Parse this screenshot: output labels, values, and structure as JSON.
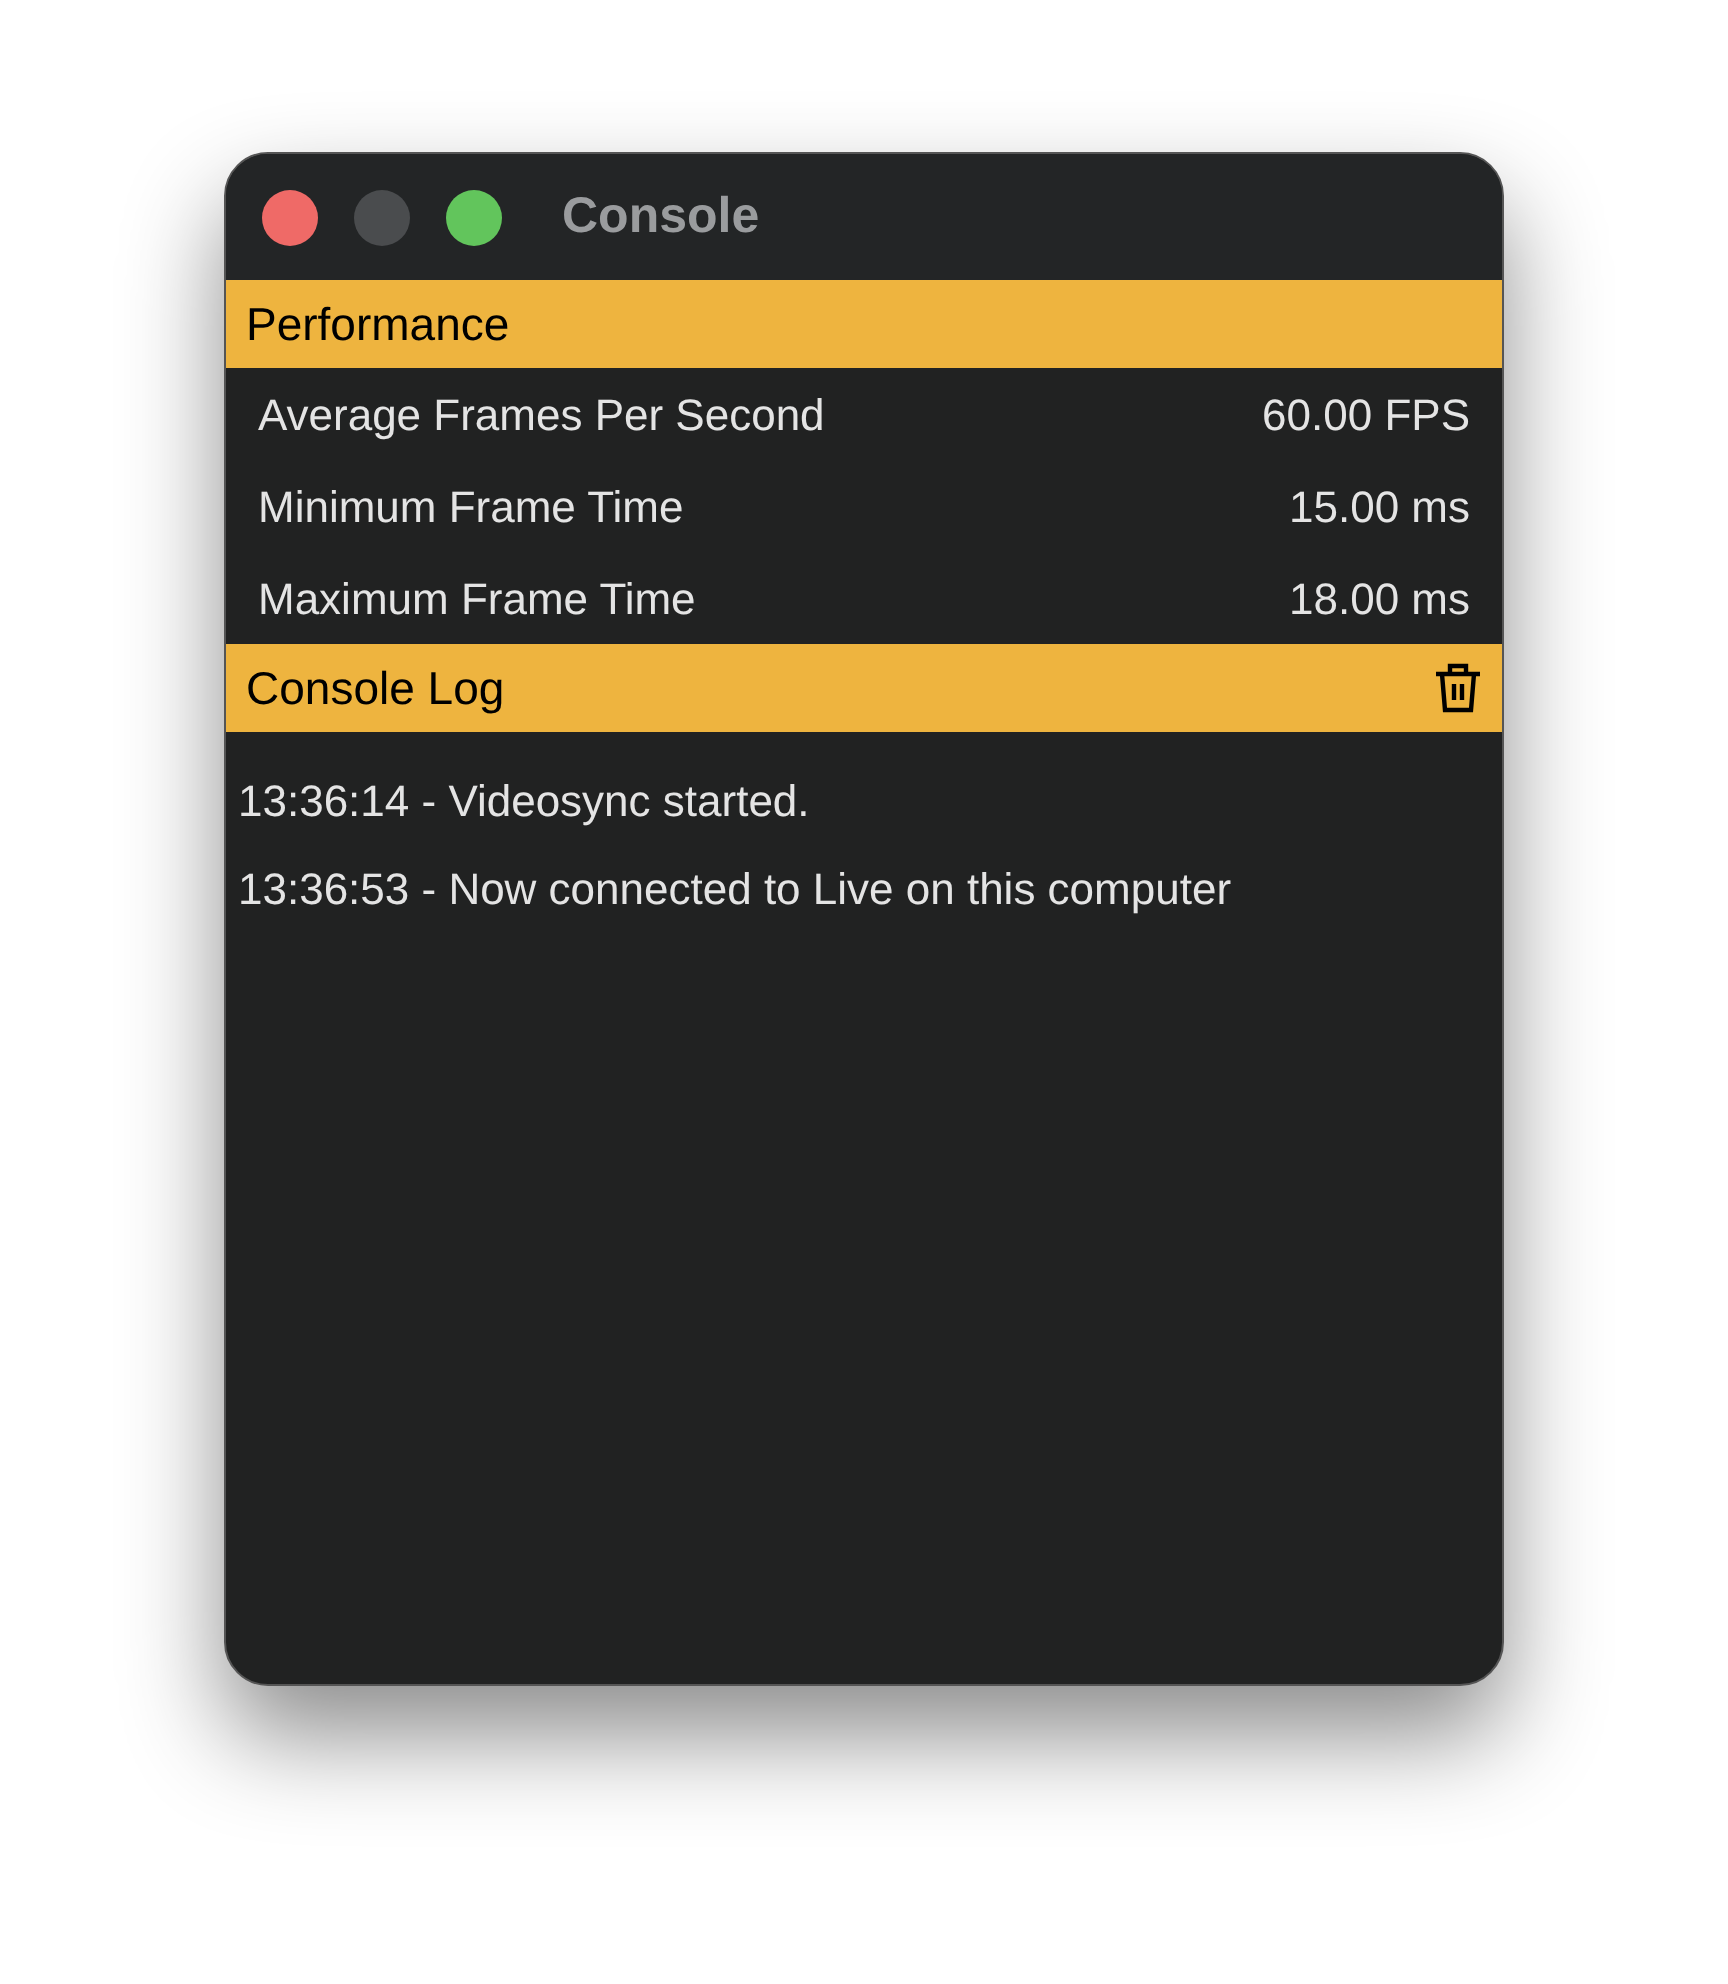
{
  "window": {
    "title": "Console"
  },
  "performance": {
    "title": "Performance",
    "rows": [
      {
        "label": "Average Frames Per Second",
        "value": "60.00 FPS"
      },
      {
        "label": "Minimum Frame Time",
        "value": "15.00 ms"
      },
      {
        "label": "Maximum Frame Time",
        "value": "18.00 ms"
      }
    ]
  },
  "console_log": {
    "title": "Console Log",
    "lines": [
      "13:36:14 - Videosync started.",
      "13:36:53 - Now connected to Live on this computer"
    ]
  }
}
